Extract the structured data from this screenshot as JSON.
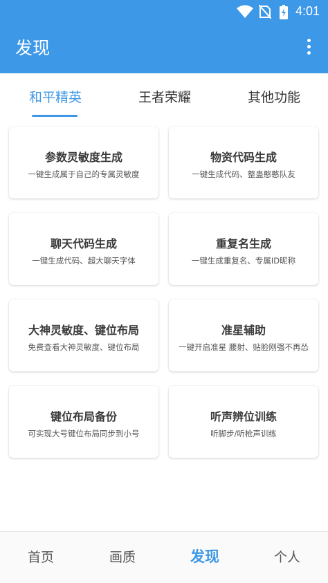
{
  "status_bar": {
    "time": "4:01",
    "icons": [
      "wifi-icon",
      "no-sim-icon",
      "battery-icon"
    ]
  },
  "header": {
    "title": "发现",
    "menu_icon": "more-vert-icon"
  },
  "tabs": [
    {
      "label": "和平精英",
      "active": true
    },
    {
      "label": "王者荣耀",
      "active": false
    },
    {
      "label": "其他功能",
      "active": false
    }
  ],
  "cards": [
    {
      "title": "参数灵敏度生成",
      "subtitle": "一键生成属于自己的专属灵敏度"
    },
    {
      "title": "物资代码生成",
      "subtitle": "一键生成代码、整蛊憨憨队友"
    },
    {
      "title": "聊天代码生成",
      "subtitle": "一键生成代码、超大聊天字体"
    },
    {
      "title": "重复名生成",
      "subtitle": "一键生成重复名、专属ID昵称"
    },
    {
      "title": "大神灵敏度、键位布局",
      "subtitle": "免费查看大神灵敏度、键位布局"
    },
    {
      "title": "准星辅助",
      "subtitle": "一键开启准星 腰射、贴脸刚强不再怂"
    },
    {
      "title": "键位布局备份",
      "subtitle": "可实现大号键位布局同步到小号"
    },
    {
      "title": "听声辨位训练",
      "subtitle": "听脚步/听枪声训练"
    }
  ],
  "bottom_nav": [
    {
      "label": "首页",
      "active": false
    },
    {
      "label": "画质",
      "active": false
    },
    {
      "label": "发现",
      "active": true
    },
    {
      "label": "个人",
      "active": false
    }
  ],
  "colors": {
    "primary": "#3d98e8",
    "text": "#333333",
    "background": "#ffffff"
  }
}
